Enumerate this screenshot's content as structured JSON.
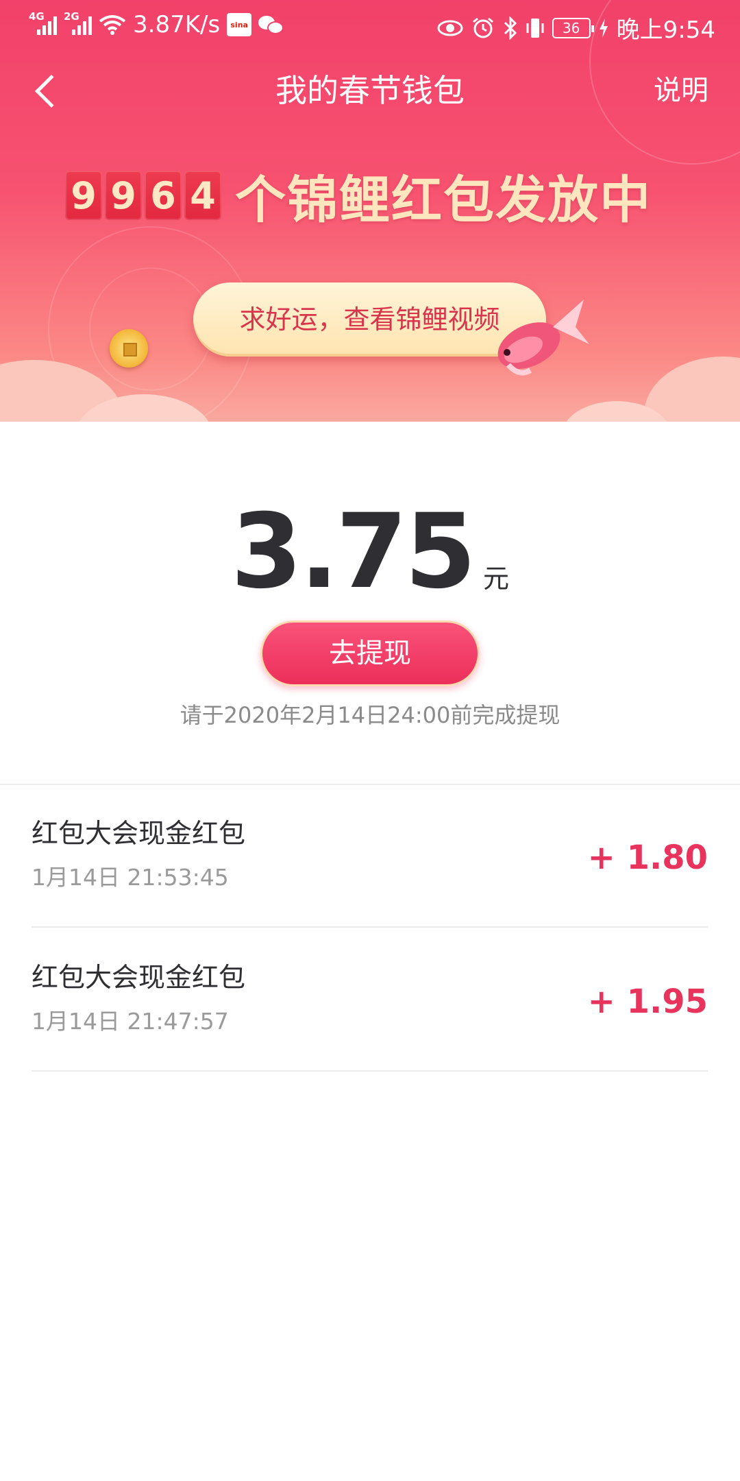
{
  "status_bar": {
    "signal1": "4G",
    "signal2": "2G",
    "speed": "3.87K/s",
    "app_icon_label": "sina",
    "battery": "36",
    "time": "晚上9:54",
    "icons": [
      "signal-icon",
      "wifi-icon",
      "sina-app-icon",
      "wechat-icon",
      "eye-icon",
      "alarm-icon",
      "bluetooth-icon",
      "vibrate-icon",
      "battery-icon",
      "charging-icon"
    ]
  },
  "header": {
    "title": "我的春节钱包",
    "help": "说明",
    "back_icon": "back-arrow-icon"
  },
  "banner": {
    "digits": [
      "9",
      "9",
      "6",
      "4"
    ],
    "counter_text": "个锦鲤红包发放中",
    "video_button": "求好运，查看锦鲤视频",
    "decor_icons": [
      "coin-icon",
      "koi-fish-icon"
    ]
  },
  "balance": {
    "amount": "3.75",
    "unit": "元",
    "withdraw_button": "去提现",
    "deadline": "请于2020年2月14日24:00前完成提现"
  },
  "records": [
    {
      "title": "红包大会现金红包",
      "time": "1月14日 21:53:45",
      "amount": "+ 1.80"
    },
    {
      "title": "红包大会现金红包",
      "time": "1月14日 21:47:57",
      "amount": "+ 1.95"
    }
  ],
  "colors": {
    "brand": "#f2416a",
    "amount_red": "#e8345c",
    "gold_text": "#ffe6bf"
  }
}
